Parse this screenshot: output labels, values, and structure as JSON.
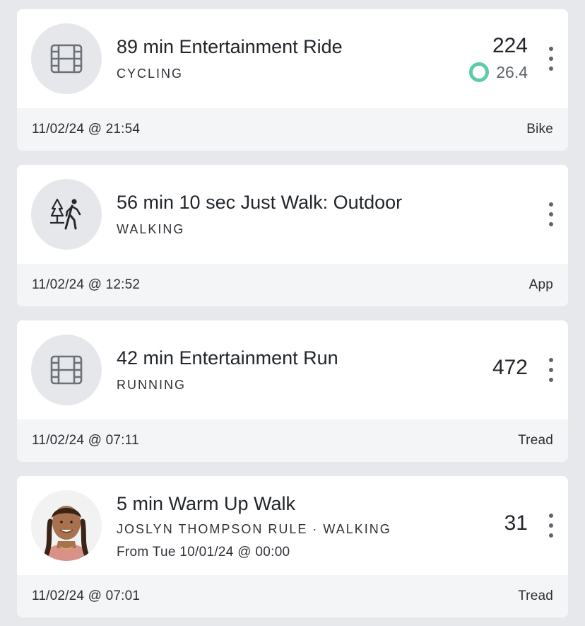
{
  "workouts": [
    {
      "title": "89 min Entertainment Ride",
      "subtitle": "CYCLING",
      "metric": "224",
      "secondary_metric": "26.4",
      "secondary_icon": "ring-icon",
      "thumbnail_icon": "film-icon",
      "date": "11/02/24 @ 21:54",
      "device": "Bike"
    },
    {
      "title": "56 min 10 sec Just Walk: Outdoor",
      "subtitle": "WALKING",
      "thumbnail_icon": "outdoor-walk-icon",
      "date": "11/02/24 @ 12:52",
      "device": "App"
    },
    {
      "title": "42 min Entertainment Run",
      "subtitle": "RUNNING",
      "metric": "472",
      "thumbnail_icon": "film-icon",
      "date": "11/02/24 @ 07:11",
      "device": "Tread"
    },
    {
      "title": "5 min Warm Up Walk",
      "subtitle": "JOSLYN THOMPSON RULE  ·  WALKING",
      "subline": "From Tue 10/01/24 @ 00:00",
      "metric": "31",
      "thumbnail_icon": "instructor-avatar",
      "date": "11/02/24 @ 07:01",
      "device": "Tread"
    }
  ],
  "colors": {
    "background": "#e6e8ec",
    "card": "#ffffff",
    "footer": "#f4f5f7",
    "ring_accent": "#5fcaa8"
  }
}
